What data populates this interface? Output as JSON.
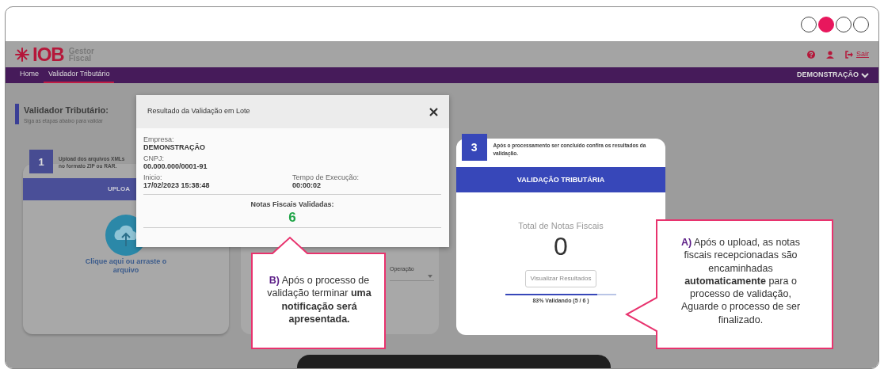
{
  "pager": {
    "dots": [
      {
        "selected": false
      },
      {
        "selected": true
      },
      {
        "selected": false
      },
      {
        "selected": false
      }
    ]
  },
  "header": {
    "logo": {
      "mark": "IOB",
      "product": [
        "Gestor",
        "Fiscal"
      ]
    },
    "logout": "Sair"
  },
  "nav": {
    "items": [
      {
        "label": "Home",
        "selected": false
      },
      {
        "label": "Validador Tributário",
        "selected": true
      }
    ],
    "company": "DEMONSTRAÇÃO"
  },
  "page": {
    "title": "Validador Tributário:",
    "subtitle": "Siga as etapas abaixo para validar"
  },
  "step_1": {
    "number": "1",
    "text": [
      "Upload dos arquivos XMLs",
      "no formato ZIP ou RAR."
    ],
    "button": "UPLOA",
    "dropzone": "Clique aqui ou arraste o arquivo"
  },
  "step_2": {
    "field_label": "Operação"
  },
  "step_3": {
    "number": "3",
    "text": "Após o processamento ser concluído confira os resultados da validação.",
    "header": "VALIDAÇÃO TRIBUTÁRIA",
    "total_label": "Total de Notas Fiscais",
    "total": "0",
    "button": "Visualizar Resultados",
    "progress": {
      "level": 0.83,
      "label": "83% Validando (5 / 6 )"
    }
  },
  "modal": {
    "title": "Resultado da Validação em Lote",
    "fields": [
      {
        "label": "Empresa:",
        "value": "DEMONSTRAÇÃO"
      },
      {
        "label": "CNPJ:",
        "value": "00.000.000/0001-91"
      },
      {
        "label": "Inicio:",
        "value": "17/02/2023 15:38:48"
      },
      {
        "label": "Tempo de Execução:",
        "value": "00:00:02"
      }
    ],
    "result_label": "Notas Fiscais Validadas:",
    "result_value": "6"
  },
  "callouts": [
    {
      "text": "**B)** Após o processo de validação terminar **uma notificação será apresentada.**"
    },
    {
      "text": "**A)** Após o upload, as notas fiscais recepcionadas são encaminhadas **automaticamente** para o processo de validação, Aguarde o processo de ser finalizado."
    }
  ]
}
